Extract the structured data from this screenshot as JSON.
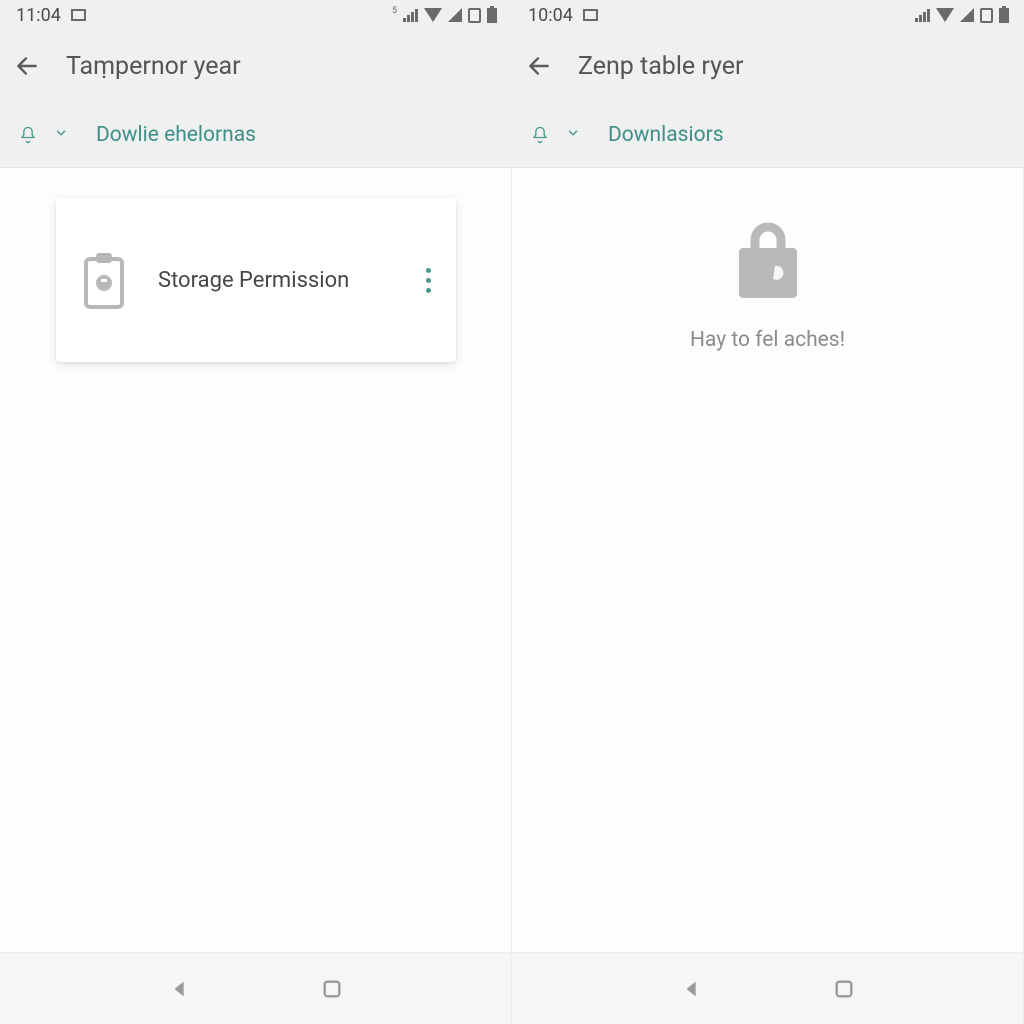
{
  "left": {
    "status": {
      "time": "11:04"
    },
    "appbar": {
      "title": "Taṃpernor year"
    },
    "filter": {
      "label": "Dowlie ehelornas"
    },
    "card": {
      "title": "Storage Permission"
    }
  },
  "right": {
    "status": {
      "time": "10:04"
    },
    "appbar": {
      "title": "Zenp table ryer"
    },
    "filter": {
      "label": "Downlasiors"
    },
    "empty": {
      "text": "Hay to fel aches!"
    }
  }
}
